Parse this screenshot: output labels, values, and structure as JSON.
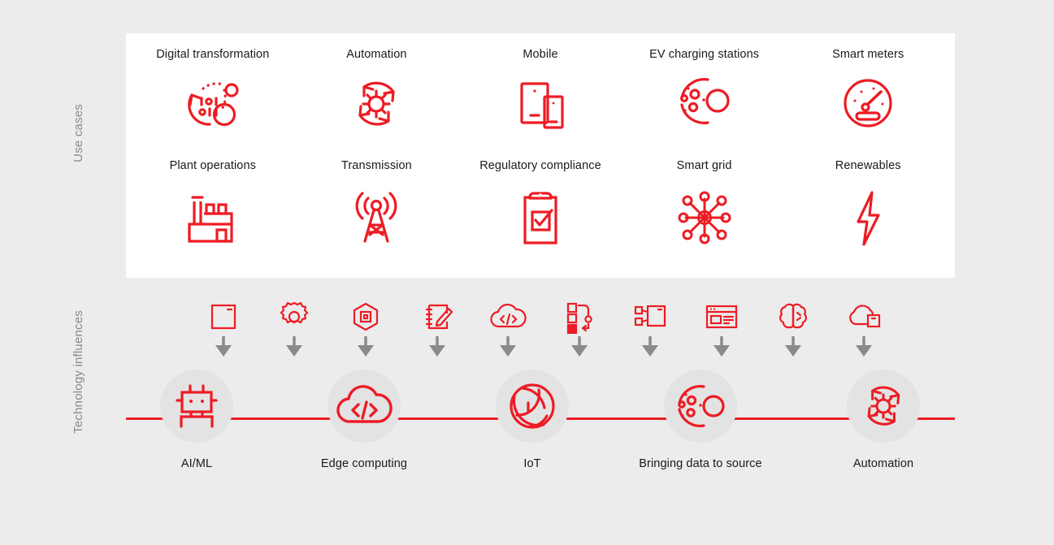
{
  "axes": {
    "use_cases": {
      "label": "Use cases",
      "direction": "up",
      "arrow_color": "#8a8a8a"
    },
    "technology_influences": {
      "label": "Technology influences",
      "direction": "down",
      "arrow_color": "#8a8a8a"
    }
  },
  "colors": {
    "accent_red": "#ed1c24",
    "page_background": "#ececec",
    "panel_background": "#ffffff",
    "node_disc": "#e3e3e3",
    "axis_gray": "#8a8a8a",
    "text_dark": "#1a1a1a"
  },
  "use_cases": {
    "rows": [
      [
        {
          "label": "Digital transformation",
          "icon": "digital-transformation-icon"
        },
        {
          "label": "Automation",
          "icon": "automation-cycle-icon"
        },
        {
          "label": "Mobile",
          "icon": "mobile-devices-icon"
        },
        {
          "label": "EV charging stations",
          "icon": "ev-charging-particles-icon"
        },
        {
          "label": "Smart meters",
          "icon": "gauge-meter-icon"
        }
      ],
      [
        {
          "label": "Plant operations",
          "icon": "factory-icon"
        },
        {
          "label": "Transmission",
          "icon": "transmission-tower-icon"
        },
        {
          "label": "Regulatory compliance",
          "icon": "clipboard-check-icon"
        },
        {
          "label": "Smart grid",
          "icon": "network-hub-icon"
        },
        {
          "label": "Renewables",
          "icon": "lightning-bolt-icon"
        }
      ]
    ]
  },
  "technology_influences": {
    "icons": [
      {
        "icon": "window-panel-icon"
      },
      {
        "icon": "gear-icon"
      },
      {
        "icon": "hexagon-chip-icon"
      },
      {
        "icon": "notepad-pencil-icon"
      },
      {
        "icon": "cloud-code-icon"
      },
      {
        "icon": "workflow-queue-icon"
      },
      {
        "icon": "network-diagram-icon"
      },
      {
        "icon": "web-layout-icon"
      },
      {
        "icon": "brain-icon"
      },
      {
        "icon": "cloud-box-icon"
      }
    ],
    "arrow_icon": "arrow-down-icon"
  },
  "timeline": {
    "nodes": [
      {
        "label": "AI/ML",
        "icon": "robot-head-icon"
      },
      {
        "label": "Edge computing",
        "icon": "cloud-code-icon"
      },
      {
        "label": "IoT",
        "icon": "iot-sphere-icon"
      },
      {
        "label": "Bringing data to source",
        "icon": "data-particles-icon"
      },
      {
        "label": "Automation",
        "icon": "automation-cycle-icon"
      }
    ]
  }
}
